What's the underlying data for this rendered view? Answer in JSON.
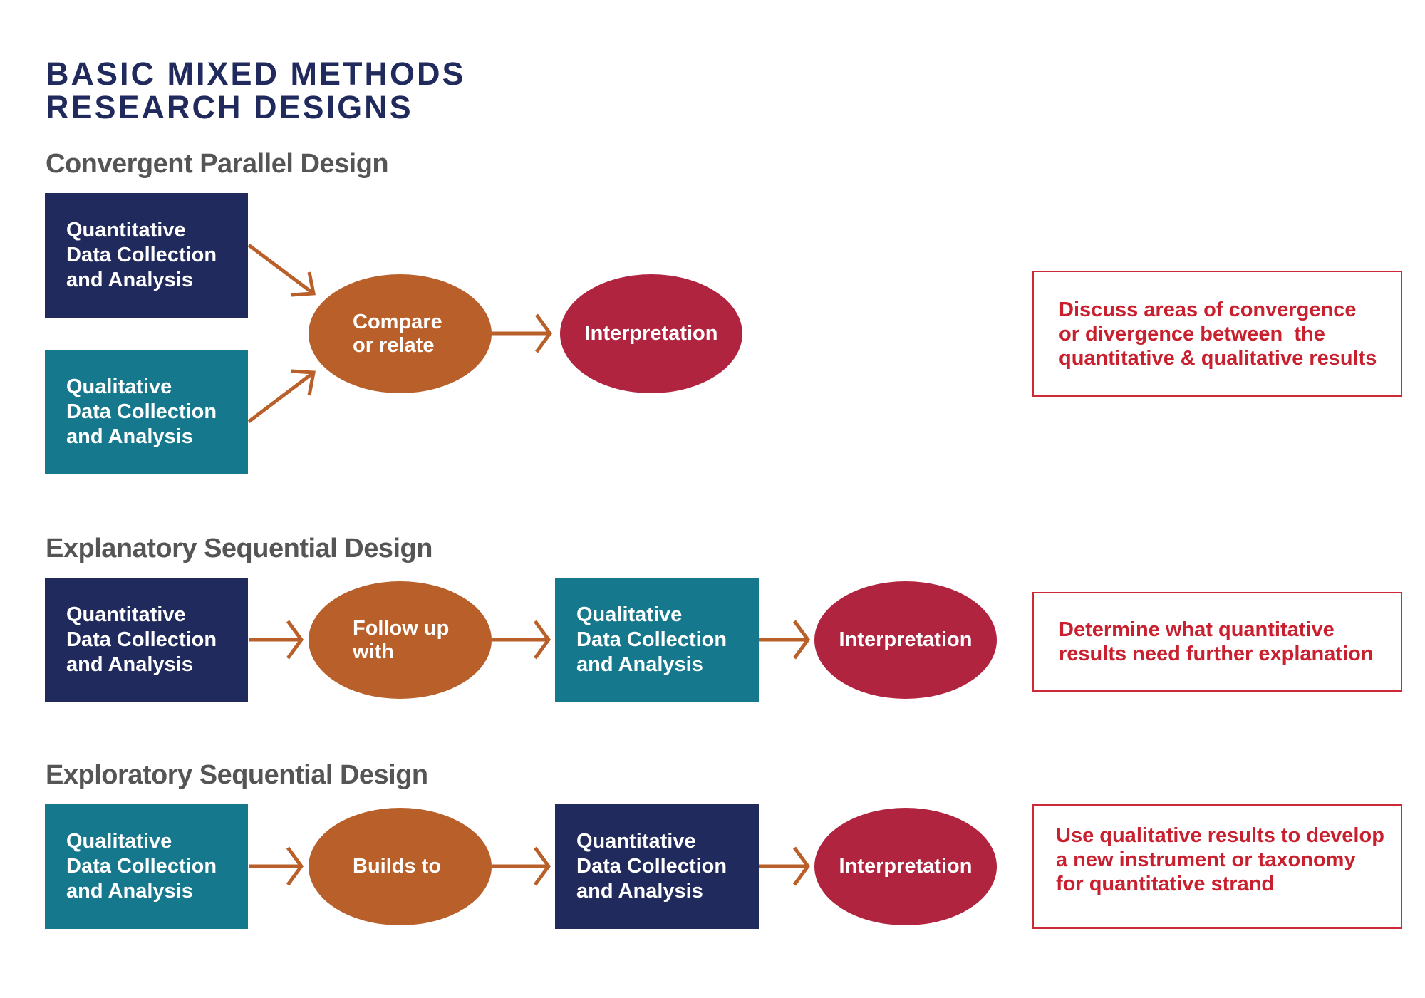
{
  "title": {
    "line1": "BASIC MIXED METHODS",
    "line2": "RESEARCH DESIGNS"
  },
  "colors": {
    "quantitative": "#212a5c",
    "qualitative": "#15788c",
    "connector": "#b95f29",
    "interpretation": "#b1243f",
    "note": "#c8202e",
    "heading": "#555555"
  },
  "designs": [
    {
      "heading": "Convergent Parallel Design",
      "nodes": {
        "quant": [
          "Quantitative",
          "Data Collection",
          "and Analysis"
        ],
        "qual": [
          "Qualitative",
          "Data Collection",
          "and Analysis"
        ],
        "connector": [
          "Compare",
          "or relate"
        ],
        "interpretation": "Interpretation"
      },
      "note": [
        "Discuss areas of convergence",
        "or divergence between  the",
        "quantitative & qualitative results"
      ]
    },
    {
      "heading": "Explanatory Sequential Design",
      "nodes": {
        "first": [
          "Quantitative",
          "Data Collection",
          "and Analysis"
        ],
        "connector": [
          "Follow up",
          "with"
        ],
        "second": [
          "Qualitative",
          "Data Collection",
          "and Analysis"
        ],
        "interpretation": "Interpretation"
      },
      "note": [
        "Determine what quantitative",
        "results need further explanation"
      ]
    },
    {
      "heading": "Exploratory Sequential Design",
      "nodes": {
        "first": [
          "Qualitative",
          "Data Collection",
          "and Analysis"
        ],
        "connector": [
          "Builds to"
        ],
        "second": [
          "Quantitative",
          "Data Collection",
          "and Analysis"
        ],
        "interpretation": "Interpretation"
      },
      "note": [
        "Use qualitative results to develop",
        "a new instrument or taxonomy",
        "for quantitative strand"
      ]
    }
  ]
}
